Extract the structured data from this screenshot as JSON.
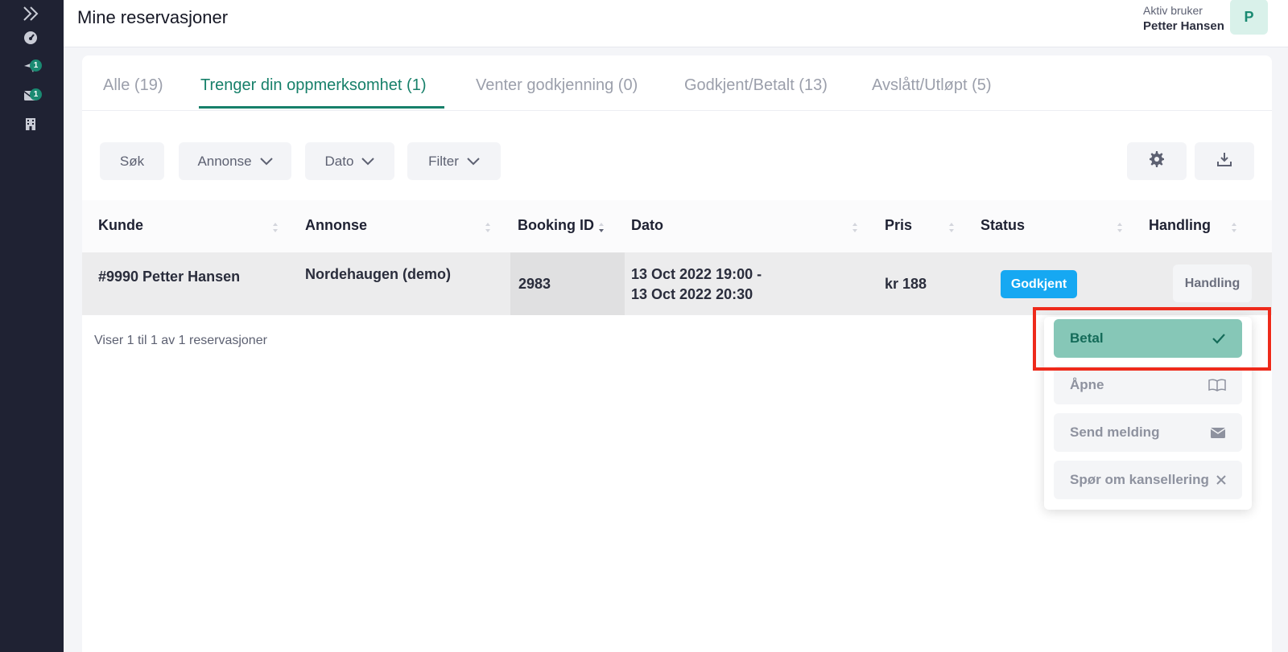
{
  "header": {
    "title": "Mine reservasjoner",
    "user_role": "Aktiv bruker",
    "user_name": "Petter Hansen",
    "avatar_letter": "P"
  },
  "sidebar": {
    "items": [
      {
        "icon": "expand-chevrons-icon"
      },
      {
        "icon": "dashboard-gauge-icon"
      },
      {
        "icon": "send-icon",
        "badge": "1"
      },
      {
        "icon": "mail-icon",
        "badge": "1"
      },
      {
        "icon": "building-icon"
      }
    ]
  },
  "tabs": [
    {
      "label": "Alle (19)",
      "active": false
    },
    {
      "label": "Trenger din oppmerksomhet (1)",
      "active": true
    },
    {
      "label": "Venter godkjenning (0)",
      "active": false
    },
    {
      "label": "Godkjent/Betalt (13)",
      "active": false
    },
    {
      "label": "Avslått/Utløpt (5)",
      "active": false
    }
  ],
  "toolbar": {
    "search_label": "Søk",
    "annonse_label": "Annonse",
    "dato_label": "Dato",
    "filter_label": "Filter"
  },
  "table": {
    "columns": [
      "Kunde",
      "Annonse",
      "Booking ID",
      "Dato",
      "Pris",
      "Status",
      "Handling"
    ],
    "rows": [
      {
        "kunde": "#9990 Petter Hansen",
        "annonse": "Nordehaugen (demo)",
        "booking_id": "2983",
        "dato_line1": "13 Oct 2022 19:00 -",
        "dato_line2": "13 Oct 2022 20:30",
        "pris": "kr 188",
        "status": "Godkjent",
        "handling": "Handling"
      }
    ],
    "footer": "Viser 1 til 1 av 1 reservasjoner"
  },
  "action_menu": {
    "items": [
      {
        "label": "Betal",
        "icon": "check-icon"
      },
      {
        "label": "Åpne",
        "icon": "book-open-icon"
      },
      {
        "label": "Send melding",
        "icon": "envelope-icon"
      },
      {
        "label": "Spør om kansellering",
        "icon": "close-icon"
      }
    ]
  },
  "colors": {
    "accent": "#17806a",
    "status_approved": "#16a8f2",
    "sidebar_bg": "#1f2233",
    "highlight": "#ee2a1b"
  }
}
